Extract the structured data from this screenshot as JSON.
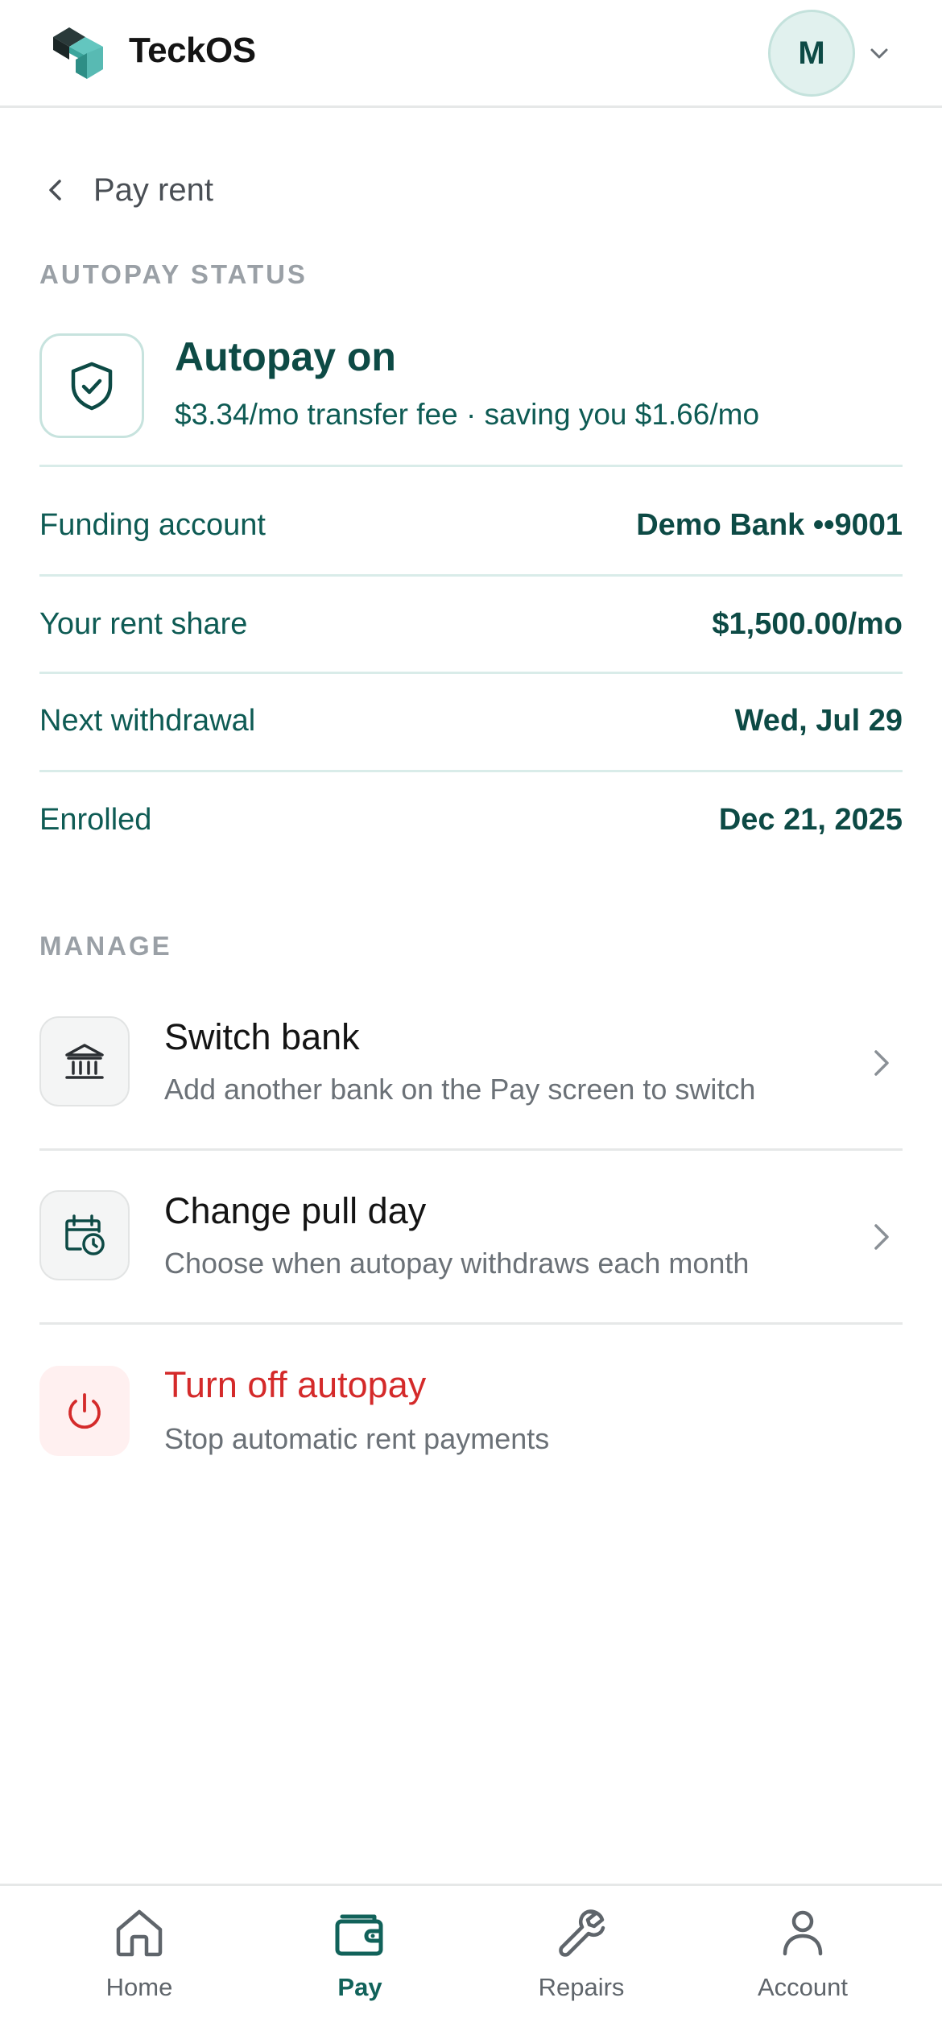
{
  "header": {
    "brand": "TeckOS",
    "avatar_initial": "M"
  },
  "nav_back": {
    "label": "Pay rent"
  },
  "autopay_status": {
    "section_label": "AUTOPAY STATUS",
    "title": "Autopay on",
    "subtitle": "$3.34/mo transfer fee · saving you $1.66/mo",
    "rows": [
      {
        "key": "Funding account",
        "value": "Demo Bank ••9001"
      },
      {
        "key": "Your rent share",
        "value": "$1,500.00/mo"
      },
      {
        "key": "Next withdrawal",
        "value": "Wed, Jul 29"
      },
      {
        "key": "Enrolled",
        "value": "Dec 21, 2025"
      }
    ]
  },
  "manage": {
    "section_label": "MANAGE",
    "items": [
      {
        "title": "Switch bank",
        "subtitle": "Add another bank on the Pay screen to switch",
        "icon": "bank-icon"
      },
      {
        "title": "Change pull day",
        "subtitle": "Choose when autopay withdraws each month",
        "icon": "calendar-clock-icon"
      },
      {
        "title": "Turn off autopay",
        "subtitle": "Stop automatic rent payments",
        "icon": "power-icon"
      }
    ]
  },
  "bottom_nav": {
    "active": "Pay",
    "items": [
      {
        "label": "Home",
        "icon": "home-icon"
      },
      {
        "label": "Pay",
        "icon": "wallet-icon"
      },
      {
        "label": "Repairs",
        "icon": "wrench-icon"
      },
      {
        "label": "Account",
        "icon": "user-icon"
      }
    ]
  },
  "colors": {
    "brand_dark": "#0d4a45",
    "brand_teal": "#11625a",
    "danger": "#d42a2a",
    "muted": "#9aa0a6"
  }
}
